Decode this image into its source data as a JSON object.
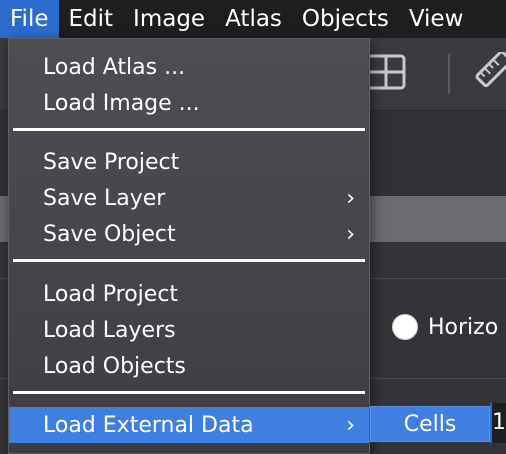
{
  "menubar": {
    "items": [
      "File",
      "Edit",
      "Image",
      "Atlas",
      "Objects",
      "View"
    ],
    "active_index": 0
  },
  "file_menu": {
    "groups": [
      {
        "items": [
          {
            "label": "Load Atlas ...",
            "submenu": false
          },
          {
            "label": "Load Image ...",
            "submenu": false
          }
        ]
      },
      {
        "items": [
          {
            "label": "Save Project",
            "submenu": false
          },
          {
            "label": "Save Layer",
            "submenu": true
          },
          {
            "label": "Save Object",
            "submenu": true
          }
        ]
      },
      {
        "items": [
          {
            "label": "Load Project",
            "submenu": false
          },
          {
            "label": "Load Layers",
            "submenu": false
          },
          {
            "label": "Load Objects",
            "submenu": false
          }
        ]
      },
      {
        "items": [
          {
            "label": "Load External Data",
            "submenu": true,
            "highlighted": true
          }
        ]
      }
    ],
    "chevron": "›"
  },
  "submenu": {
    "items": [
      "Cells"
    ]
  },
  "background": {
    "radio_label": "Horizo",
    "input_value": "1"
  },
  "colors": {
    "accent": "#3f7fe0",
    "menubar_active": "#2c6ccc",
    "menubar_bg": "#1e1e20"
  },
  "icons": {
    "grid": "grid-icon",
    "ruler": "ruler-icon",
    "chevron": "chevron-right-icon"
  }
}
